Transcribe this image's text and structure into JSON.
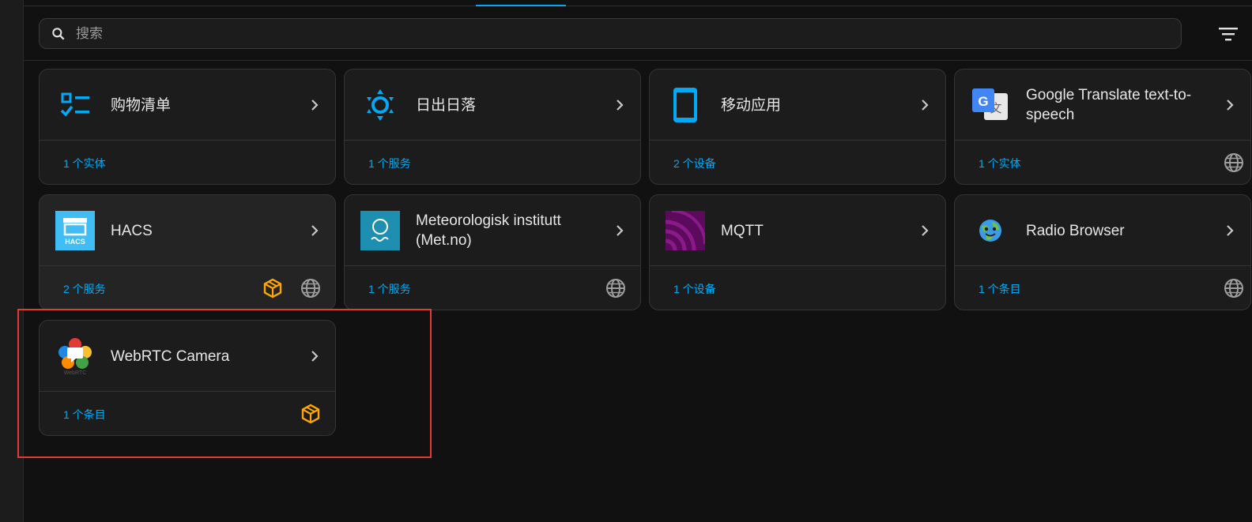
{
  "search": {
    "placeholder": "搜索"
  },
  "cards": [
    {
      "title": "购物清单",
      "link": "1 个实体",
      "logo": "shopping-list-icon"
    },
    {
      "title": "日出日落",
      "link": "1 个服务",
      "logo": "sun-icon"
    },
    {
      "title": "移动应用",
      "link": "2 个设备",
      "logo": "mobile-app-icon"
    },
    {
      "title": "Google Translate text-to-speech",
      "link": "1 个实体",
      "logo": "google-translate-logo",
      "badges": [
        "cloud-globe-icon"
      ]
    },
    {
      "title": "HACS",
      "link": "2 个服务",
      "logo": "hacs-logo",
      "badges": [
        "custom-integration-icon",
        "cloud-globe-icon"
      ]
    },
    {
      "title": "Meteorologisk institutt (Met.no)",
      "link": "1 个服务",
      "logo": "met-no-logo",
      "badges": [
        "cloud-globe-icon"
      ]
    },
    {
      "title": "MQTT",
      "link": "1 个设备",
      "logo": "mqtt-logo"
    },
    {
      "title": "Radio Browser",
      "link": "1 个条目",
      "logo": "radio-browser-logo",
      "badges": [
        "cloud-globe-icon"
      ]
    },
    {
      "title": "WebRTC Camera",
      "link": "1 个条目",
      "logo": "webrtc-logo",
      "logo_text": "WebRTC",
      "badges": [
        "custom-integration-icon"
      ]
    }
  ],
  "hacs_logo_text": "HACS",
  "colors": {
    "accent": "#03a9f4",
    "highlight": "#e53935",
    "custom_badge": "#ffa600"
  }
}
